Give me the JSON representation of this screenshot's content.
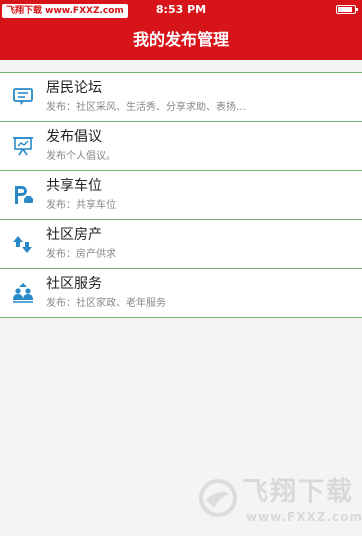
{
  "status_bar": {
    "watermark": "飞翔下载 www.FXXZ.com",
    "time": "8:53 PM"
  },
  "navbar": {
    "title": "我的发布管理"
  },
  "items": [
    {
      "title": "居民论坛",
      "subtitle": "发布：社区采风、生活秀、分享求助、表扬…",
      "icon": "forum-icon"
    },
    {
      "title": "发布倡议",
      "subtitle": "发布个人倡议。",
      "icon": "presentation-board-icon"
    },
    {
      "title": "共享车位",
      "subtitle": "发布：共享车位",
      "icon": "parking-icon"
    },
    {
      "title": "社区房产",
      "subtitle": "发布：房产供求",
      "icon": "house-arrows-icon"
    },
    {
      "title": "社区服务",
      "subtitle": "发布：社区家政、老年服务",
      "icon": "people-service-icon"
    }
  ],
  "watermark": {
    "brand": "飞翔下载",
    "url": "www.FXXZ.com"
  },
  "colors": {
    "primary": "#d7141a",
    "divider": "#74b874",
    "icon": "#2a8ac8"
  }
}
